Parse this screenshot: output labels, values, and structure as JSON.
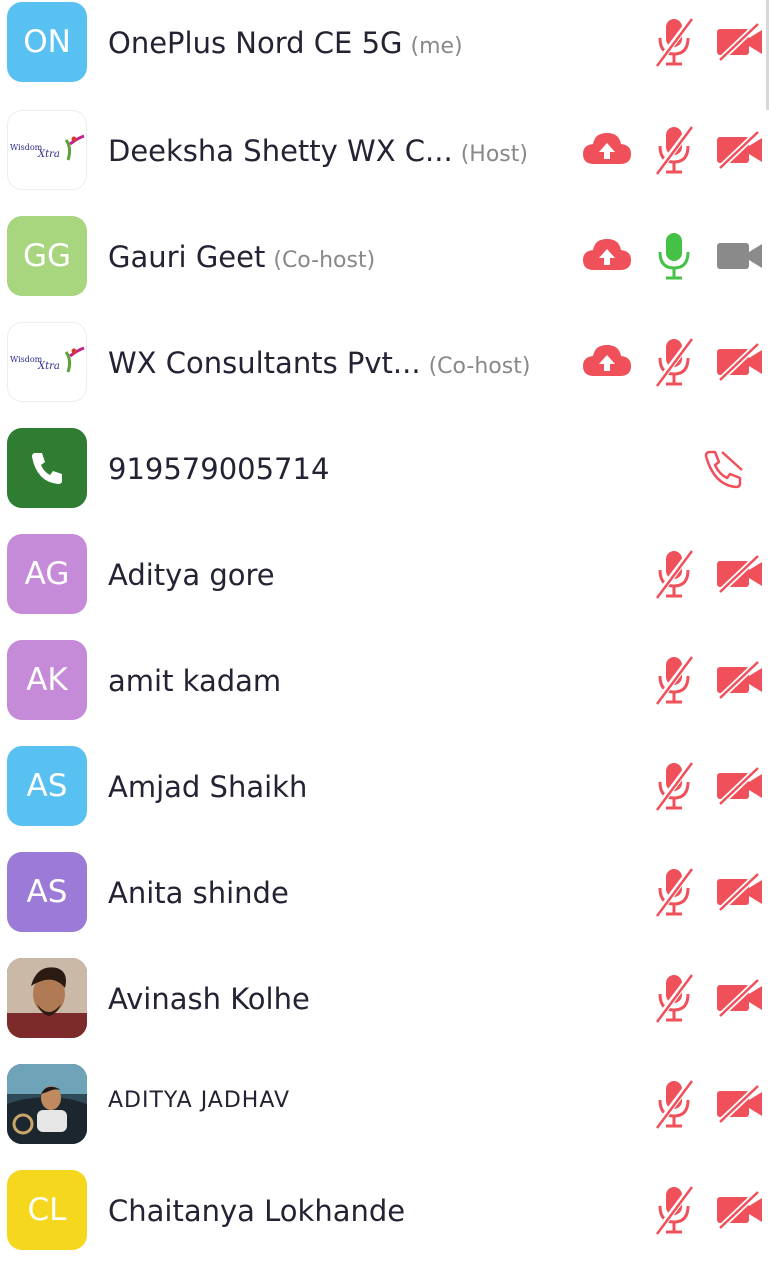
{
  "participants": [
    {
      "initials": "ON",
      "color": "#58c1f2",
      "name": "OnePlus Nord CE 5G",
      "role": "(me)",
      "mic": "muted",
      "video": "off",
      "cloud": false
    },
    {
      "initials": "",
      "logo": "WisdomXtra",
      "name": "Deeksha Shetty WX C...",
      "role": "(Host)",
      "mic": "muted",
      "video": "off",
      "cloud": true
    },
    {
      "initials": "GG",
      "color": "#a8d67f",
      "name": "Gauri Geet",
      "role": "(Co-host)",
      "mic": "on",
      "video": "off-gray",
      "cloud": true
    },
    {
      "initials": "",
      "logo": "WisdomXtra",
      "name": "WX Consultants Pvt...",
      "role": "(Co-host)",
      "mic": "muted",
      "video": "off",
      "cloud": true
    },
    {
      "initials": "",
      "phone": true,
      "color": "#2e7d32",
      "name": "919579005714",
      "role": "",
      "call": "ended"
    },
    {
      "initials": "AG",
      "color": "#c58ad8",
      "name": "Aditya gore",
      "role": "",
      "mic": "muted",
      "video": "off",
      "cloud": false
    },
    {
      "initials": "AK",
      "color": "#c58ad8",
      "name": "amit kadam",
      "role": "",
      "mic": "muted",
      "video": "off",
      "cloud": false
    },
    {
      "initials": "AS",
      "color": "#58c1f2",
      "name": "Amjad Shaikh",
      "role": "",
      "mic": "muted",
      "video": "off",
      "cloud": false
    },
    {
      "initials": "AS",
      "color": "#9b7ad8",
      "name": "Anita shinde",
      "role": "",
      "mic": "muted",
      "video": "off",
      "cloud": false
    },
    {
      "initials": "",
      "photo": true,
      "name": "Avinash Kolhe",
      "role": "",
      "mic": "muted",
      "video": "off",
      "cloud": false
    },
    {
      "initials": "",
      "photo": true,
      "name": "ADITYA JADHAV",
      "role": "",
      "mic": "muted",
      "video": "off",
      "cloud": false
    },
    {
      "initials": "CL",
      "color": "#f5d81e",
      "name": "Chaitanya Lokhande",
      "role": "",
      "mic": "muted",
      "video": "off",
      "cloud": false
    }
  ],
  "colors": {
    "muted": "#f0505a",
    "mic_on": "#45c145",
    "video_gray": "#8a8a8a"
  },
  "icons": [
    "cloud-recording-icon",
    "mic-muted-icon",
    "mic-on-icon",
    "video-off-icon",
    "video-icon",
    "call-ended-icon",
    "phone-icon"
  ]
}
